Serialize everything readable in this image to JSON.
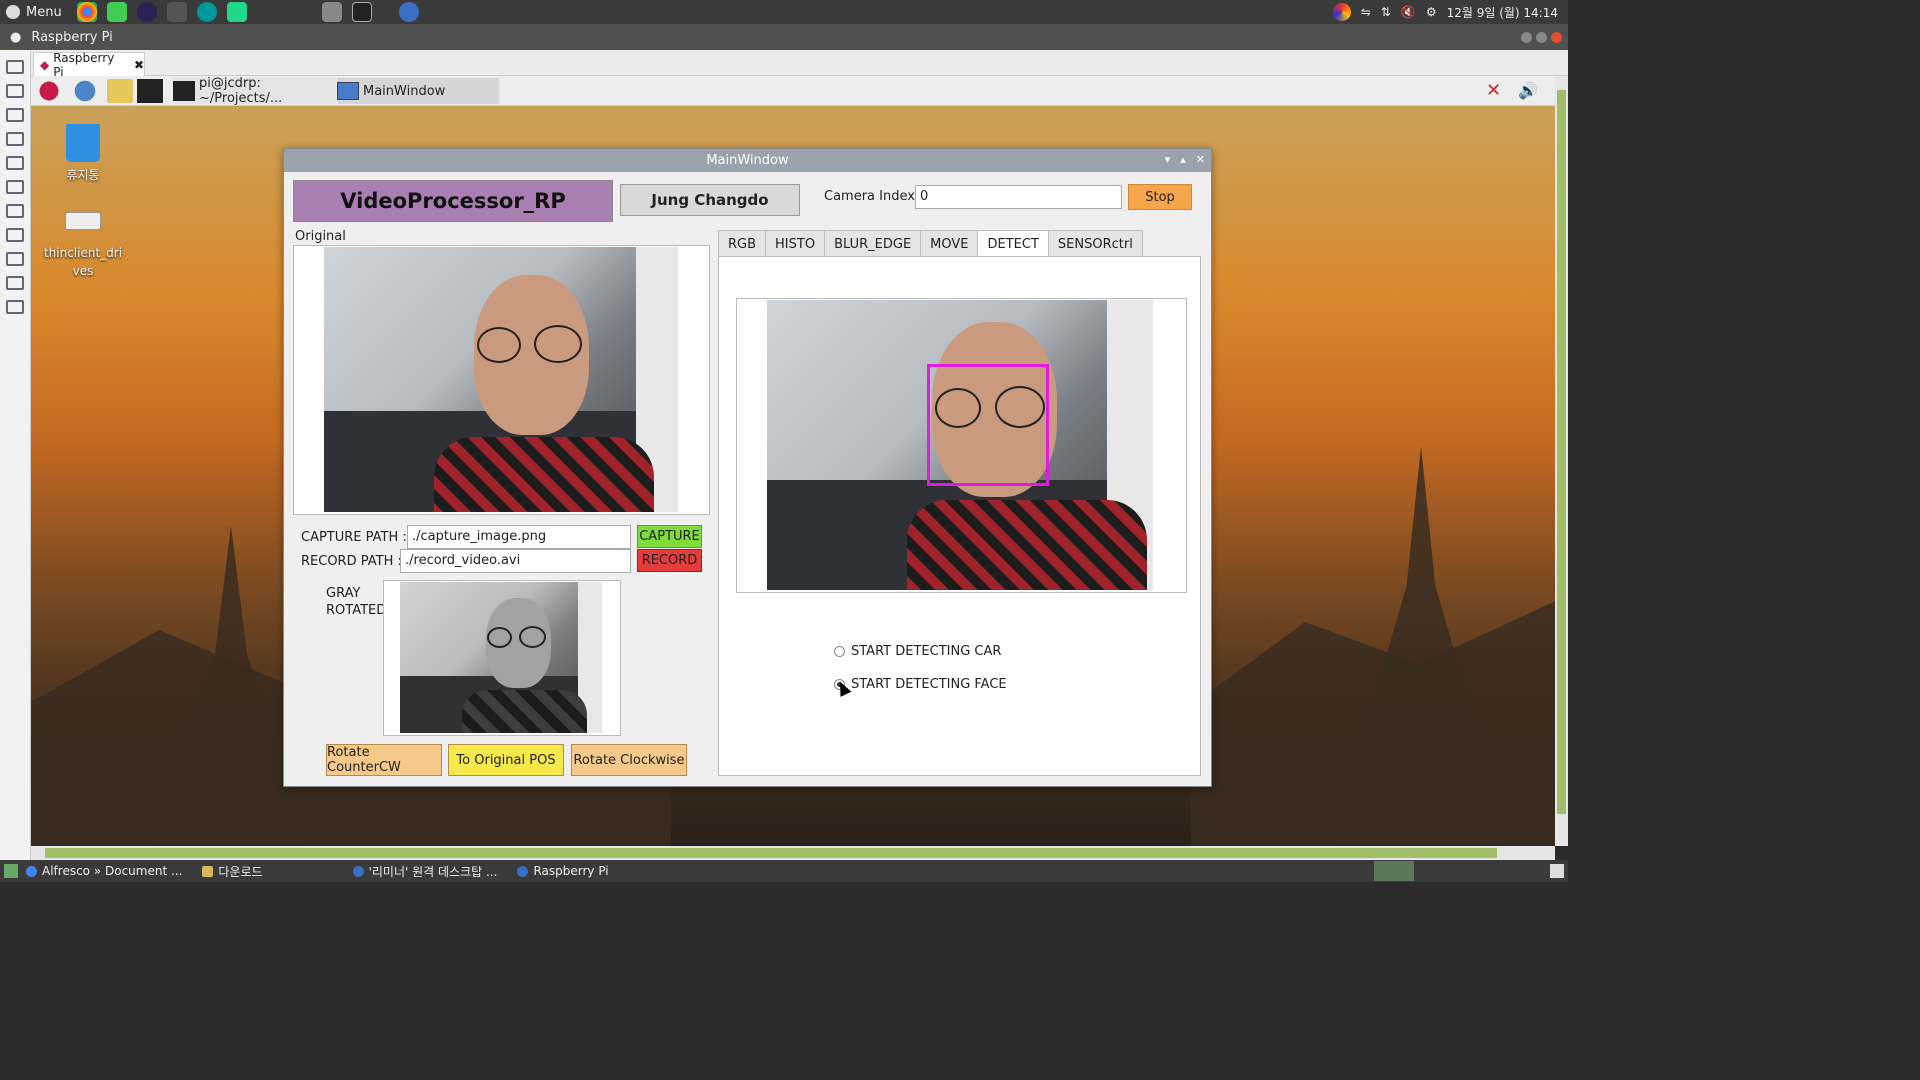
{
  "system_bar": {
    "menu_label": "Menu",
    "clock": "12월 9일 (월) 14:14"
  },
  "remote_title": "Raspberry Pi",
  "tab": {
    "label": "Raspberry Pi"
  },
  "pi_taskbar": {
    "terminal_label": "pi@jcdrp: ~/Projects/...",
    "mainwindow_label": "MainWindow"
  },
  "desktop": {
    "icons": [
      {
        "label": "휴지통"
      },
      {
        "label": "thinclient_drives"
      }
    ]
  },
  "main_window": {
    "title": "MainWindow",
    "app_name": "VideoProcessor_RP",
    "author": "Jung Changdo",
    "camera_index_label": "Camera Index :",
    "camera_index_value": "0",
    "stop_label": "Stop",
    "original_label": "Original",
    "capture_path_label": "CAPTURE PATH :",
    "capture_path_value": "./capture_image.png",
    "capture_button": "CAPTURE",
    "record_path_label": "RECORD PATH :",
    "record_path_value": "./record_video.avi",
    "record_button": "RECORD",
    "gray_label_1": "GRAY",
    "gray_label_2": "ROTATED",
    "rotate_ccw": "Rotate CounterCW",
    "to_original": "To Original POS",
    "rotate_cw": "Rotate Clockwise",
    "tabs": [
      "RGB",
      "HISTO",
      "BLUR_EDGE",
      "MOVE",
      "DETECT",
      "SENSORctrl"
    ],
    "active_tab": "DETECT",
    "detect_options": [
      {
        "label": "START DETECTING CAR",
        "checked": false
      },
      {
        "label": "START DETECTING FACE",
        "checked": true
      }
    ]
  },
  "bottom_taskbar": {
    "items": [
      "Alfresco » Document ...",
      "다운로드",
      "'리미너' 원격 데스크탑 ...",
      "Raspberry Pi"
    ]
  },
  "colors": {
    "app_name_bg": "#a97fb1",
    "stop_bg": "#f5a54a",
    "capture_bg": "#7fdc3c",
    "record_bg": "#e53c3c",
    "face_box": "#e01ce0",
    "rotate_btn_bg": "#f5c98a",
    "original_btn_bg": "#f5e84a"
  }
}
